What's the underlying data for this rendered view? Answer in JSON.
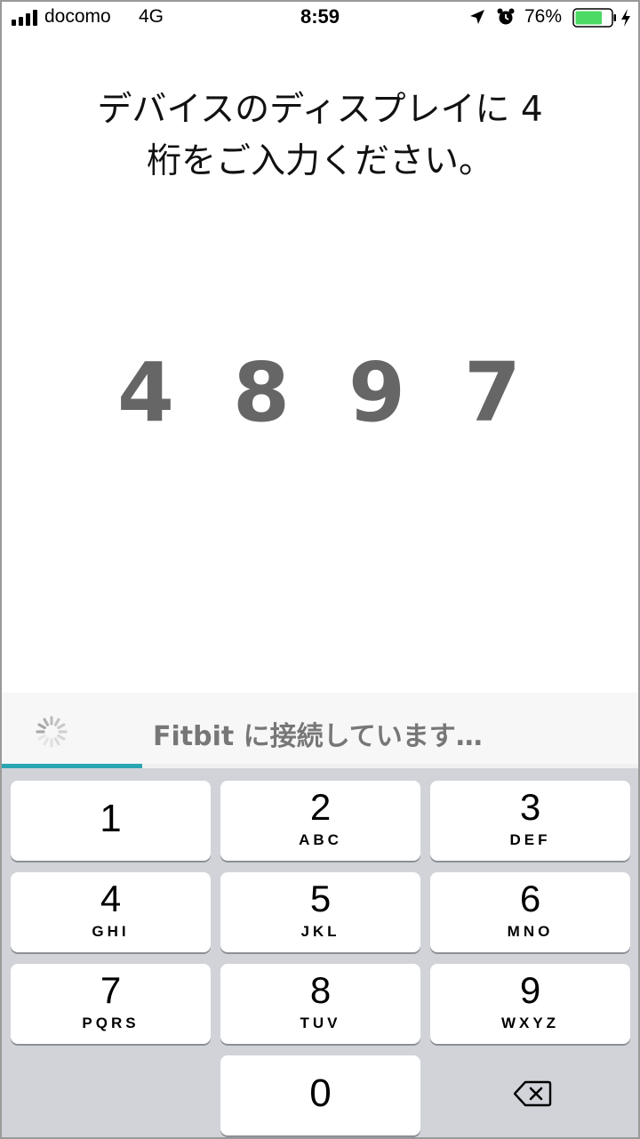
{
  "status_bar": {
    "carrier": "docomo",
    "network": "4G",
    "time": "8:59",
    "battery_percent": "76%",
    "battery_level": 0.76,
    "icons": [
      "signal-icon",
      "location-arrow-icon",
      "alarm-clock-icon",
      "battery-icon",
      "charging-bolt-icon"
    ]
  },
  "instruction": {
    "line1": "デバイスのディスプレイに 4",
    "line2": "桁をご入力ください。"
  },
  "code": {
    "digits": [
      "4",
      "8",
      "9",
      "7"
    ]
  },
  "connection": {
    "text": "Fitbit に接続しています…",
    "progress": 0.22,
    "accent_color": "#2aa7b2"
  },
  "keypad": {
    "keys": [
      {
        "num": "1",
        "letters": ""
      },
      {
        "num": "2",
        "letters": "ABC"
      },
      {
        "num": "3",
        "letters": "DEF"
      },
      {
        "num": "4",
        "letters": "GHI"
      },
      {
        "num": "5",
        "letters": "JKL"
      },
      {
        "num": "6",
        "letters": "MNO"
      },
      {
        "num": "7",
        "letters": "PQRS"
      },
      {
        "num": "8",
        "letters": "TUV"
      },
      {
        "num": "9",
        "letters": "WXYZ"
      },
      {
        "num": "0",
        "letters": ""
      }
    ],
    "backspace_icon": "backspace-icon"
  }
}
